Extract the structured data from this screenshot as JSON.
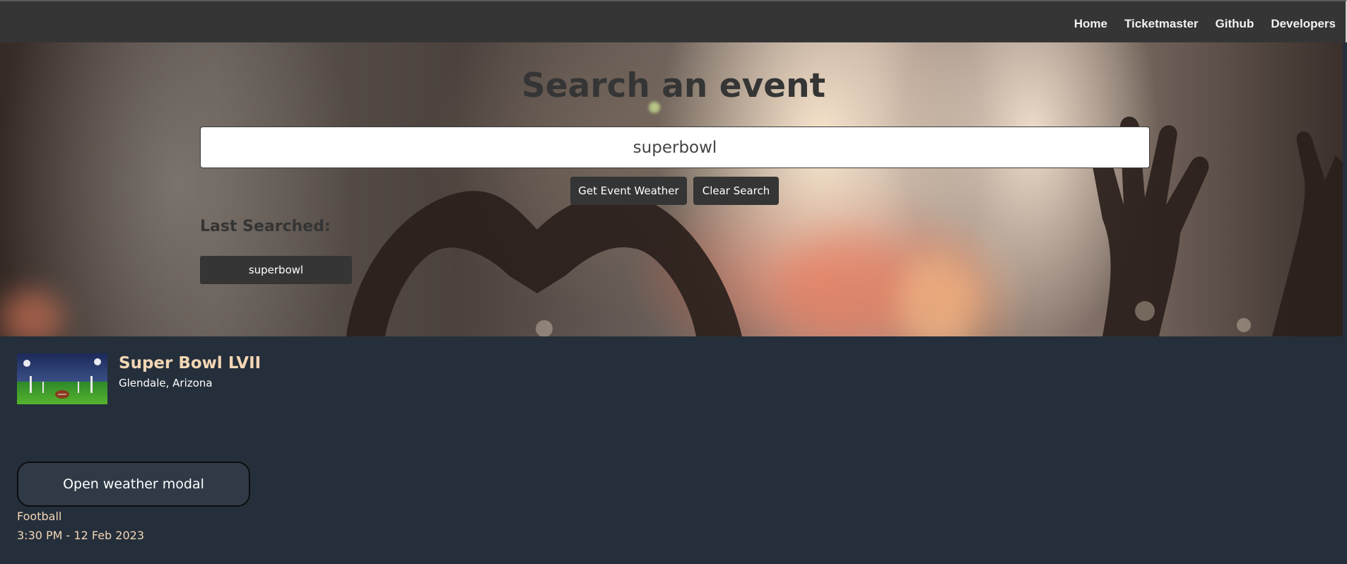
{
  "nav": {
    "links": [
      "Home",
      "Ticketmaster",
      "Github",
      "Developers"
    ]
  },
  "hero": {
    "title": "Search an event",
    "search_value": "superbowl",
    "get_weather_label": "Get Event Weather",
    "clear_label": "Clear Search",
    "last_searched_heading": "Last Searched:",
    "history": [
      "superbowl"
    ]
  },
  "event": {
    "title": "Super Bowl LVII",
    "location": "Glendale, Arizona",
    "modal_button_label": "Open weather modal",
    "genre": "Football",
    "datetime": "3:30 PM - 12 Feb 2023"
  },
  "colors": {
    "navbar": "#353535",
    "results_bg": "#252f3b",
    "accent_text": "#f3d6b5",
    "button_dark": "#353535"
  }
}
